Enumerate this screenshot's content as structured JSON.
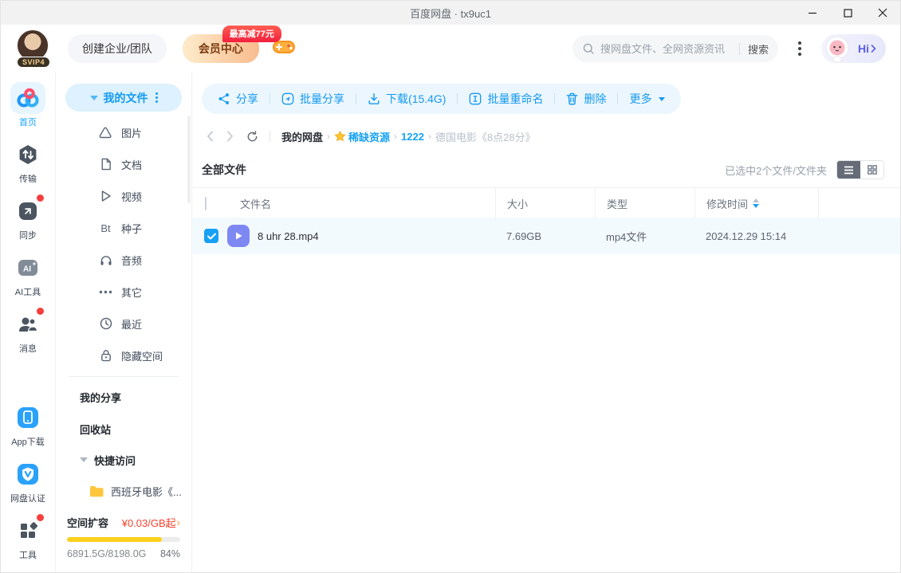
{
  "titlebar": {
    "title": "百度网盘 · tx9uc1"
  },
  "header": {
    "avatar_badge": "SVIP4",
    "create_team": "创建企业/团队",
    "vip_center": "会员中心",
    "vip_badge": "最高减77元",
    "search_placeholder": "搜网盘文件、全网资源资讯",
    "search_button": "搜索",
    "hi_label": "Hi"
  },
  "rail": {
    "items": [
      {
        "label": "首页",
        "icon": "netdisk-logo",
        "active": true
      },
      {
        "label": "传输",
        "icon": "transfer-icon"
      },
      {
        "label": "同步",
        "icon": "sync-icon",
        "dot": true
      },
      {
        "label": "AI工具",
        "icon": "ai-icon"
      },
      {
        "label": "消息",
        "icon": "messages-icon",
        "dot": true
      }
    ],
    "bottom": [
      {
        "label": "App下载",
        "icon": "phone-icon"
      },
      {
        "label": "网盘认证",
        "icon": "shield-v-icon"
      },
      {
        "label": "工具",
        "icon": "tools-icon",
        "dot": true
      }
    ]
  },
  "sidebar": {
    "my_files": "我的文件",
    "categories": [
      {
        "label": "图片",
        "icon": "image-icon"
      },
      {
        "label": "文档",
        "icon": "document-icon"
      },
      {
        "label": "视频",
        "icon": "video-icon"
      },
      {
        "label": "种子",
        "icon": "bt-icon",
        "icon_text": "Bt"
      },
      {
        "label": "音频",
        "icon": "audio-icon"
      },
      {
        "label": "其它",
        "icon": "ellipsis-icon"
      },
      {
        "label": "最近",
        "icon": "clock-icon"
      },
      {
        "label": "隐藏空间",
        "icon": "lock-icon"
      }
    ],
    "links": [
      {
        "label": "我的分享"
      },
      {
        "label": "回收站"
      }
    ],
    "quick_access": "快捷访问",
    "quick_folder": "西班牙电影《...",
    "storage": {
      "label": "空间扩容",
      "price": "¥0.03/GB起",
      "chevron": "›",
      "usage": "6891.5G/8198.0G",
      "percent": "84%",
      "percent_value": 84
    }
  },
  "toolbar": {
    "items": [
      {
        "label": "分享",
        "icon": "share-icon"
      },
      {
        "label": "批量分享",
        "icon": "batch-share-icon"
      },
      {
        "label": "下载(15.4G)",
        "icon": "download-icon"
      },
      {
        "label": "批量重命名",
        "icon": "rename-icon"
      },
      {
        "label": "删除",
        "icon": "trash-icon"
      },
      {
        "label": "更多",
        "icon": "chevron-down-icon"
      }
    ]
  },
  "breadcrumb": {
    "separator": "›",
    "items": [
      {
        "label": "我的网盘",
        "style": "strong"
      },
      {
        "label": "稀缺资源",
        "style": "blue",
        "star": true
      },
      {
        "label": "1222",
        "style": "blue"
      },
      {
        "label": "德国电影《8点28分》",
        "style": "muted"
      }
    ]
  },
  "filelist": {
    "title": "全部文件",
    "selection_info": "已选中2个文件/文件夹",
    "columns": [
      "文件名",
      "大小",
      "类型",
      "修改时间"
    ],
    "rows": [
      {
        "name": "8 uhr 28.mp4",
        "size": "7.69GB",
        "type": "mp4文件",
        "modified": "2024.12.29 15:14",
        "selected": true,
        "icon": "video-file-icon"
      }
    ]
  },
  "colors": {
    "accent_blue": "#149af0",
    "toolbar_bg": "#ecf6fe",
    "selected_row_bg": "#f3fafd",
    "progress_yellow": "#fcd11d",
    "price_red": "#f5422d",
    "folder_yellow": "#ffc53d",
    "video_file_purple": "#7e88f2",
    "badge_red": "#f2203e"
  }
}
